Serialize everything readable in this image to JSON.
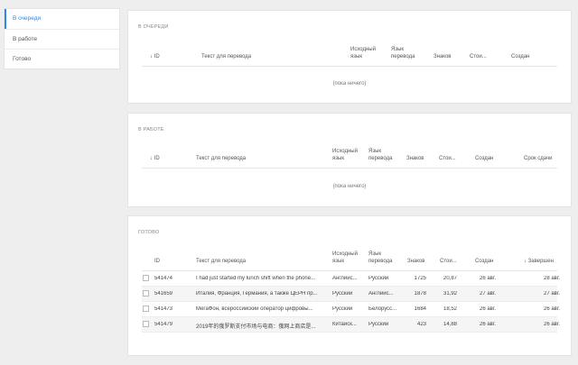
{
  "nav": {
    "items": [
      {
        "label": "В очереди"
      },
      {
        "label": "В работе"
      },
      {
        "label": "Готово"
      }
    ]
  },
  "queue": {
    "title": "В ОЧЕРЕДИ",
    "columns": {
      "id": "ID",
      "text": "Текст для перевода",
      "src": "Исходный язык",
      "tgt": "Язык перевода",
      "chars": "Знаков",
      "cost": "Стои...",
      "created": "Создан"
    },
    "empty": "(пока ничего)"
  },
  "work": {
    "title": "В РАБОТЕ",
    "columns": {
      "id": "ID",
      "text": "Текст для перевода",
      "src": "Исходный язык",
      "tgt": "Язык перевода",
      "chars": "Знаков",
      "cost": "Стои...",
      "created": "Создан",
      "deadline": "Срок сдачи"
    },
    "empty": "(пока ничего)"
  },
  "done": {
    "title": "ГОТОВО",
    "columns": {
      "id": "ID",
      "text": "Текст для перевода",
      "src": "Исходный язык",
      "tgt": "Язык перевода",
      "chars": "Знаков",
      "cost": "Стои...",
      "created": "Создан",
      "completed": "Завершен"
    },
    "rows": [
      {
        "id": "541474",
        "text": "I had just started my lunch shift when the phone...",
        "src": "Английс...",
        "tgt": "Русский",
        "chars": "1725",
        "cost": "20,87",
        "created": "26 авг.",
        "completed": "28 авг."
      },
      {
        "id": "541659",
        "text": "Италия, Франция, Германия, а также ЦЕРН пр...",
        "src": "Русский",
        "tgt": "Английс...",
        "chars": "1878",
        "cost": "31,92",
        "created": "27 авг.",
        "completed": "27 авг."
      },
      {
        "id": "541473",
        "text": "МегаФон, всероссийский оператор цифровы...",
        "src": "Русский",
        "tgt": "Белорусс...",
        "chars": "1684",
        "cost": "18,52",
        "created": "26 авг.",
        "completed": "26 авг."
      },
      {
        "id": "541479",
        "text": "2019年的俄罗斯支付市场与电商：俄网上商店是...",
        "src": "Китайск...",
        "tgt": "Русский",
        "chars": "423",
        "cost": "14,88",
        "created": "26 авг.",
        "completed": "26 авг."
      }
    ]
  }
}
